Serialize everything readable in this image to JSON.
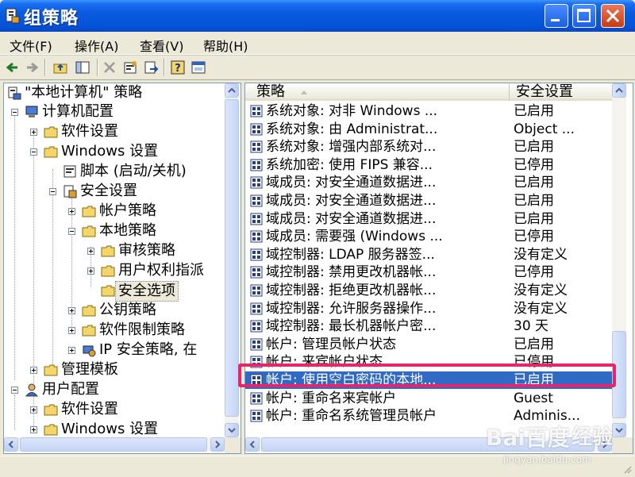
{
  "window": {
    "title": "组策略"
  },
  "menu": [
    {
      "label": "文件(F)"
    },
    {
      "label": "操作(A)"
    },
    {
      "label": "查看(V)"
    },
    {
      "label": "帮助(H)"
    }
  ],
  "tree": {
    "root": "\"本地计算机\" 策略",
    "computer_config": "计算机配置",
    "software_settings": "软件设置",
    "windows_settings": "Windows 设置",
    "scripts": "脚本 (启动/关机)",
    "security_settings": "安全设置",
    "account_policies": "帐户策略",
    "local_policies": "本地策略",
    "audit_policy": "审核策略",
    "user_rights": "用户权利指派",
    "security_options": "安全选项",
    "public_key": "公钥策略",
    "software_restriction": "软件限制策略",
    "ip_security": "IP 安全策略, 在",
    "admin_templates": "管理模板",
    "user_config": "用户配置",
    "user_software_settings": "软件设置",
    "user_windows_settings": "Windows 设置"
  },
  "list": {
    "columns": {
      "policy": "策略",
      "setting": "安全设置"
    },
    "rows": [
      {
        "policy": "系统对象: 对非 Windows ...",
        "setting": "已启用"
      },
      {
        "policy": "系统对象: 由 Administrat...",
        "setting": "Object ..."
      },
      {
        "policy": "系统对象: 增强内部系统对...",
        "setting": "已启用"
      },
      {
        "policy": "系统加密: 使用 FIPS 兼容...",
        "setting": "已停用"
      },
      {
        "policy": "域成员: 对安全通道数据进...",
        "setting": "已启用"
      },
      {
        "policy": "域成员: 对安全通道数据进...",
        "setting": "已启用"
      },
      {
        "policy": "域成员: 对安全通道数据进...",
        "setting": "已启用"
      },
      {
        "policy": "域成员: 需要强 (Windows ...",
        "setting": "已停用"
      },
      {
        "policy": "域控制器: LDAP 服务器签...",
        "setting": "没有定义"
      },
      {
        "policy": "域控制器: 禁用更改机器帐...",
        "setting": "已停用"
      },
      {
        "policy": "域控制器: 拒绝更改机器帐...",
        "setting": "没有定义"
      },
      {
        "policy": "域控制器: 允许服务器操作...",
        "setting": "没有定义"
      },
      {
        "policy": "域控制器: 最长机器帐户密...",
        "setting": "30 天"
      },
      {
        "policy": "帐户: 管理员帐户状态",
        "setting": "已启用"
      },
      {
        "policy": "帐户: 来宾帐户状态",
        "setting": "已停用"
      },
      {
        "policy": "帐户: 使用空白密码的本地...",
        "setting": "已启用"
      },
      {
        "policy": "帐户: 重命名来宾帐户",
        "setting": "Guest"
      },
      {
        "policy": "帐户: 重命名系统管理员帐户",
        "setting": "Adminis..."
      }
    ],
    "selected_index": 15
  },
  "watermark": {
    "brand": "Bai百度",
    "jingyan": "经验",
    "url": "jingyan.baidu.com"
  },
  "colors": {
    "title_bar": "#0a5ae0",
    "selection": "#316ac5",
    "highlight_box": "#e5266b"
  }
}
